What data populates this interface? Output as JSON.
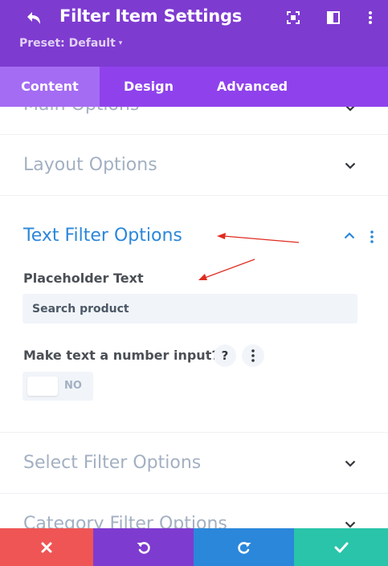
{
  "header": {
    "title": "Filter Item Settings",
    "preset_label": "Preset: Default",
    "preset_caret": "▾",
    "back_icon": "undo-arrow-icon",
    "action_icons": [
      "expand-icon",
      "split-view-icon",
      "more-vertical-icon"
    ],
    "background_color": "#7e3bd0"
  },
  "tabs": [
    {
      "label": "Content",
      "active": true
    },
    {
      "label": "Design",
      "active": false
    },
    {
      "label": "Advanced",
      "active": false
    }
  ],
  "sections": {
    "main": {
      "title": "Main Options",
      "expanded": false
    },
    "layout": {
      "title": "Layout Options",
      "expanded": false
    },
    "text_filter": {
      "title": "Text Filter Options",
      "expanded": true,
      "placeholder_label": "Placeholder Text",
      "placeholder_value": "Search product",
      "number_input_label": "Make text a number input?",
      "help_glyph": "?",
      "toggle_state_label": "NO"
    },
    "select_filter": {
      "title": "Select Filter Options",
      "expanded": false
    },
    "category_filter": {
      "title": "Category Filter Options",
      "expanded": false
    }
  },
  "footer": {
    "buttons": [
      {
        "name": "cancel",
        "icon": "close-icon",
        "color": "#ef5555"
      },
      {
        "name": "undo",
        "icon": "undo-icon",
        "color": "#7e3bd0"
      },
      {
        "name": "redo",
        "icon": "redo-icon",
        "color": "#2b87da"
      },
      {
        "name": "save",
        "icon": "check-icon",
        "color": "#29c4a9"
      }
    ]
  },
  "colors": {
    "accent_blue": "#2b87da",
    "tab_bar": "#8f42ec",
    "active_tab": "#a46cf3",
    "section_title_muted": "#a3b0c2",
    "annotation_arrow": "#e02b20"
  }
}
